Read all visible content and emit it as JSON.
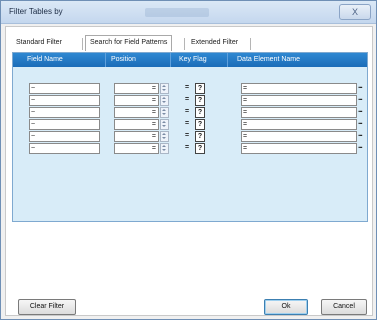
{
  "window": {
    "title": "Filter Tables by",
    "close_label": "X"
  },
  "tabs": [
    {
      "label": "Standard Filter",
      "active": false
    },
    {
      "label": "Search for Field Patterns",
      "active": true
    },
    {
      "label": "Extended Filter",
      "active": false
    }
  ],
  "grid": {
    "headers": {
      "field_name": "Field Name",
      "position": "Position",
      "key_flag": "Key Flag",
      "data_element_name": "Data Element Name"
    },
    "rows": [
      {
        "field_name": "~",
        "position_op": "=",
        "key_flag_op": "=",
        "key_flag": "?",
        "data_element": "=",
        "more": "..."
      },
      {
        "field_name": "~",
        "position_op": "=",
        "key_flag_op": "=",
        "key_flag": "?",
        "data_element": "=",
        "more": "..."
      },
      {
        "field_name": "~",
        "position_op": "=",
        "key_flag_op": "=",
        "key_flag": "?",
        "data_element": "=",
        "more": "..."
      },
      {
        "field_name": "~",
        "position_op": "=",
        "key_flag_op": "=",
        "key_flag": "?",
        "data_element": "=",
        "more": "..."
      },
      {
        "field_name": "~",
        "position_op": "=",
        "key_flag_op": "=",
        "key_flag": "?",
        "data_element": "=",
        "more": "..."
      },
      {
        "field_name": "~",
        "position_op": "=",
        "key_flag_op": "=",
        "key_flag": "?",
        "data_element": "=",
        "more": "..."
      }
    ]
  },
  "buttons": {
    "clear_filter": "Clear Filter",
    "ok": "Ok",
    "cancel": "Cancel"
  }
}
